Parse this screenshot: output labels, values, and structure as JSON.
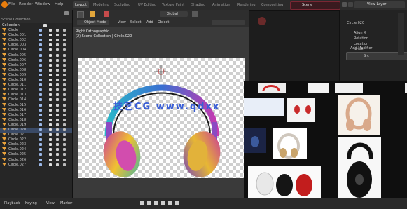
{
  "menu": [
    "File",
    "Render",
    "Window",
    "Help"
  ],
  "workspaces": [
    "Layout",
    "Modeling",
    "Sculpting",
    "UV Editing",
    "Texture Paint",
    "Shading",
    "Animation",
    "Rendering",
    "Compositing"
  ],
  "active_workspace": "Layout",
  "scene_name": "Scene",
  "view_layer": "View Layer",
  "outliner": {
    "header": "Scene Collection",
    "collection": "Collection",
    "items": [
      "Circle",
      "Circle.001",
      "Circle.002",
      "Circle.003",
      "Circle.004",
      "Circle.005",
      "Circle.006",
      "Circle.007",
      "Circle.008",
      "Circle.009",
      "Circle.010",
      "Circle.011",
      "Circle.012",
      "Circle.013",
      "Circle.014",
      "Circle.015",
      "Circle.016",
      "Circle.017",
      "Circle.018",
      "Circle.019",
      "Circle.020",
      "Circle.021",
      "Circle.022",
      "Circle.023",
      "Circle.024",
      "Circle.025",
      "Circle.026",
      "Circle.027"
    ],
    "selected_index": 20
  },
  "viewport": {
    "mode": "Object Mode",
    "menus": [
      "View",
      "Select",
      "Add",
      "Object"
    ],
    "shading": "Global",
    "info_line1": "Right Orthographic",
    "info_line2": "(2) Scene Collection | Circle.020"
  },
  "watermark": "技艺CG  www.qdxx",
  "properties": {
    "object_name": "Circle.020",
    "items": [
      "Align X",
      "Rotation",
      "Location",
      "Scale",
      "Add Modifier"
    ],
    "image_name": "Image",
    "bottom_label": "Src"
  },
  "bottom_bar": {
    "left": [
      "Playback",
      "Keying",
      "View",
      "Marker"
    ]
  },
  "colors": {
    "accent_blue": "#4772b3",
    "scene_red": "#7a2733",
    "object_orange": "#e9a23b",
    "watermark_blue": "#3a5fd6"
  }
}
